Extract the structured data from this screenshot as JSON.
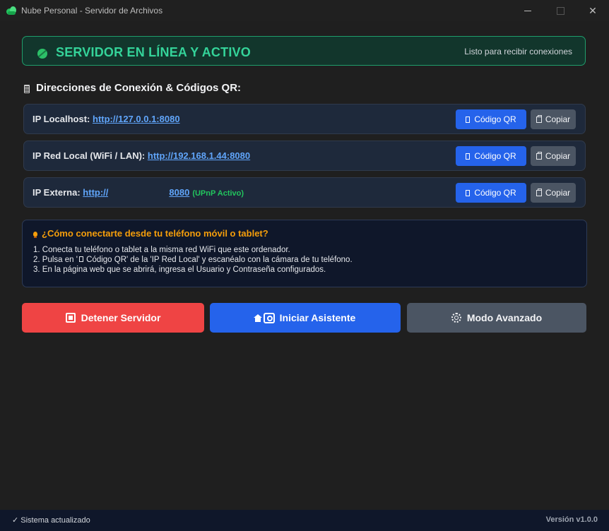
{
  "window": {
    "title": "Nube Personal - Servidor de Archivos",
    "minimize_glyph": "",
    "close_glyph": "✕"
  },
  "status_banner": {
    "title": "SERVIDOR EN LÍNEA Y ACTIVO",
    "subtitle": "Listo para recibir conexiones",
    "accent_color": "#34d399"
  },
  "connections": {
    "heading": "Direcciones de Conexión & Códigos QR:",
    "qr_label": "Código QR",
    "copy_label": "Copiar",
    "rows": [
      {
        "label": "IP Localhost: ",
        "url": "http://127.0.0.1:8080"
      },
      {
        "label": "IP Red Local (WiFi / LAN): ",
        "url": "http://192.168.1.44:8080"
      },
      {
        "label": "IP Externa: ",
        "url_start": "http://",
        "url_end": "8080",
        "note": "(UPnP Activo)"
      }
    ]
  },
  "help": {
    "title": "¿Cómo conectarte desde tu teléfono móvil o tablet?",
    "step1": "1. Conecta tu teléfono o tablet a la misma red WiFi que este ordenador.",
    "step2_prefix": "2. Pulsa en '",
    "step2_suffix": " Código QR' de la 'IP Red Local' y escanéalo con la cámara de tu teléfono.",
    "step3": "3. En la página web que se abrirá, ingresa el Usuario y Contraseña configurados."
  },
  "actions": {
    "stop_label": "Detener Servidor",
    "wizard_label": "Iniciar Asistente",
    "advanced_label": "Modo Avanzado",
    "stop_color": "#ef4444",
    "wizard_color": "#2563eb",
    "advanced_color": "#4b5563"
  },
  "statusbar": {
    "left": "✓ Sistema actualizado",
    "right": "Versión v1.0.0"
  }
}
